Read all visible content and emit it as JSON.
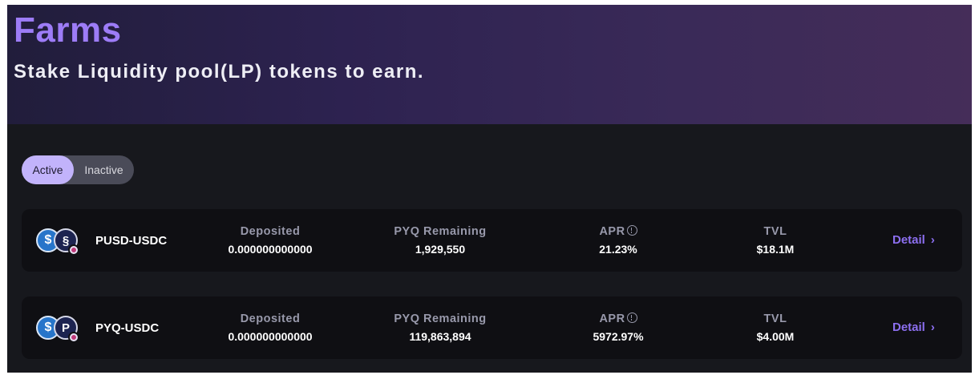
{
  "header": {
    "title": "Farms",
    "subtitle": "Stake Liquidity pool(LP) tokens to earn."
  },
  "filter": {
    "active_label": "Active",
    "inactive_label": "Inactive"
  },
  "colors": {
    "accent": "#9d7cf7",
    "toggle_active": "#c2b3fb",
    "row_bg": "#0f0f13",
    "page_bg": "#17181d"
  },
  "farms": [
    {
      "pair": "PUSD-USDC",
      "icons": [
        "usdc-icon",
        "pusd-icon",
        "badge-icon"
      ],
      "deposited_label": "Deposited",
      "deposited": "0.000000000000",
      "remaining_label": "PYQ Remaining",
      "remaining": "1,929,550",
      "apr_label": "APR",
      "apr": "21.23%",
      "tvl_label": "TVL",
      "tvl": "$18.1M",
      "detail_label": "Detail"
    },
    {
      "pair": "PYQ-USDC",
      "icons": [
        "usdc-icon",
        "pyq-icon",
        "badge-icon"
      ],
      "deposited_label": "Deposited",
      "deposited": "0.000000000000",
      "remaining_label": "PYQ Remaining",
      "remaining": "119,863,894",
      "apr_label": "APR",
      "apr": "5972.97%",
      "tvl_label": "TVL",
      "tvl": "$4.00M",
      "detail_label": "Detail"
    }
  ]
}
